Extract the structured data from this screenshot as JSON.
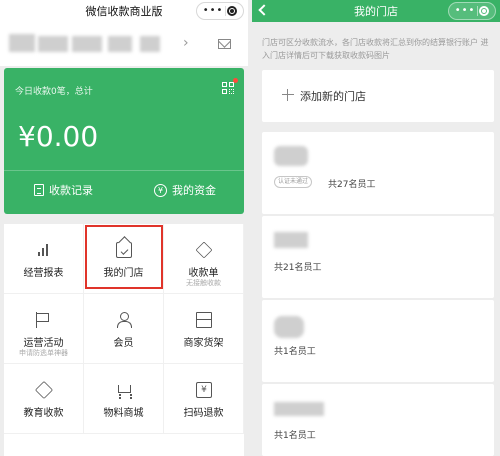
{
  "left": {
    "title": "微信收款商业版",
    "card": {
      "subtitle": "今日收款0笔，总计",
      "amount": "¥0.00",
      "records_label": "收款记录",
      "funds_label": "我的资金",
      "color": "#39b266"
    },
    "grid": [
      {
        "label": "经营报表",
        "sub": "",
        "icon": "bar-chart-icon"
      },
      {
        "label": "我的门店",
        "sub": "",
        "icon": "store-icon"
      },
      {
        "label": "收款单",
        "sub": "无接触收款",
        "icon": "tag-icon"
      },
      {
        "label": "运营活动",
        "sub": "申请防逃单神器",
        "icon": "flag-icon"
      },
      {
        "label": "会员",
        "sub": "",
        "icon": "user-icon"
      },
      {
        "label": "商家货架",
        "sub": "",
        "icon": "shelf-icon"
      },
      {
        "label": "教育收款",
        "sub": "",
        "icon": "diamond-icon"
      },
      {
        "label": "物料商城",
        "sub": "",
        "icon": "cart-icon"
      },
      {
        "label": "扫码退款",
        "sub": "",
        "icon": "scan-refund-icon"
      }
    ],
    "highlight_color": "#e0342a"
  },
  "right": {
    "title": "我的门店",
    "notice": "门店可区分收款流水，各门店收款将汇总到你的结算银行账户 进入门店详情后可下载获取收款码图片",
    "add_label": "添加新的门店",
    "stores": [
      {
        "badge": "认证未通过",
        "count": "共27名员工"
      },
      {
        "badge": "",
        "count": "共21名员工"
      },
      {
        "badge": "",
        "count": "共1名员工"
      },
      {
        "badge": "",
        "count": "共1名员工"
      }
    ]
  }
}
